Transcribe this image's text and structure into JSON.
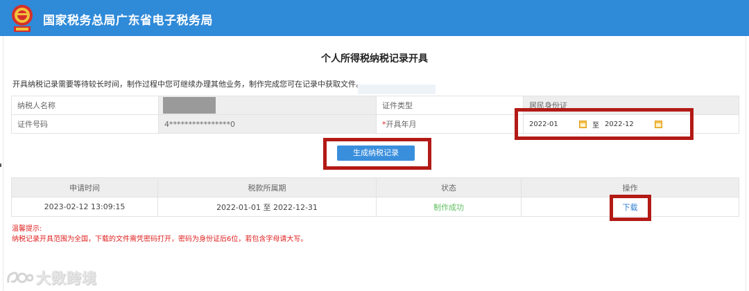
{
  "header": {
    "title": "国家税务总局广东省电子税务局",
    "emblem_icon": "national-tax-emblem-icon"
  },
  "page": {
    "title": "个人所得税纳税记录开具",
    "notice": "开具纳税记录需要等待较长时间，制作过程中您可继续办理其他业务，制作完成您可在记录中获取文件。"
  },
  "form": {
    "taxpayer_name_label": "纳税人名称",
    "taxpayer_name_value": "",
    "id_type_label": "证件类型",
    "id_type_value": "居民身份证",
    "id_number_label": "证件号码",
    "id_number_value": "4****************0",
    "period_label": "开具年月",
    "required_mark": "*",
    "start_month": "2022-01",
    "to_text": "至",
    "end_month": "2022-12"
  },
  "generate_button": {
    "label": "生成纳税记录"
  },
  "records": {
    "headers": [
      "申请时间",
      "税款所属期",
      "状态",
      "操作"
    ],
    "rows": [
      {
        "apply_time": "2023-02-12 13:09:15",
        "period": "2022-01-01 至 2022-12-31",
        "status": "制作成功",
        "action": "下载"
      }
    ]
  },
  "tips": {
    "title": "温馨提示:",
    "body": "纳税记录开具范围为全国，下载的文件需凭密码打开，密码为身份证后6位，若包含字母请大写。"
  },
  "watermark": {
    "text": "大数跨境"
  },
  "colors": {
    "header_bg": "#2f8ad8",
    "button_bg": "#3a8fdd",
    "highlight_box": "#b31a16",
    "status_success": "#5fbf5f",
    "tip_red": "#e02020",
    "link_blue": "#2f7fd0"
  }
}
